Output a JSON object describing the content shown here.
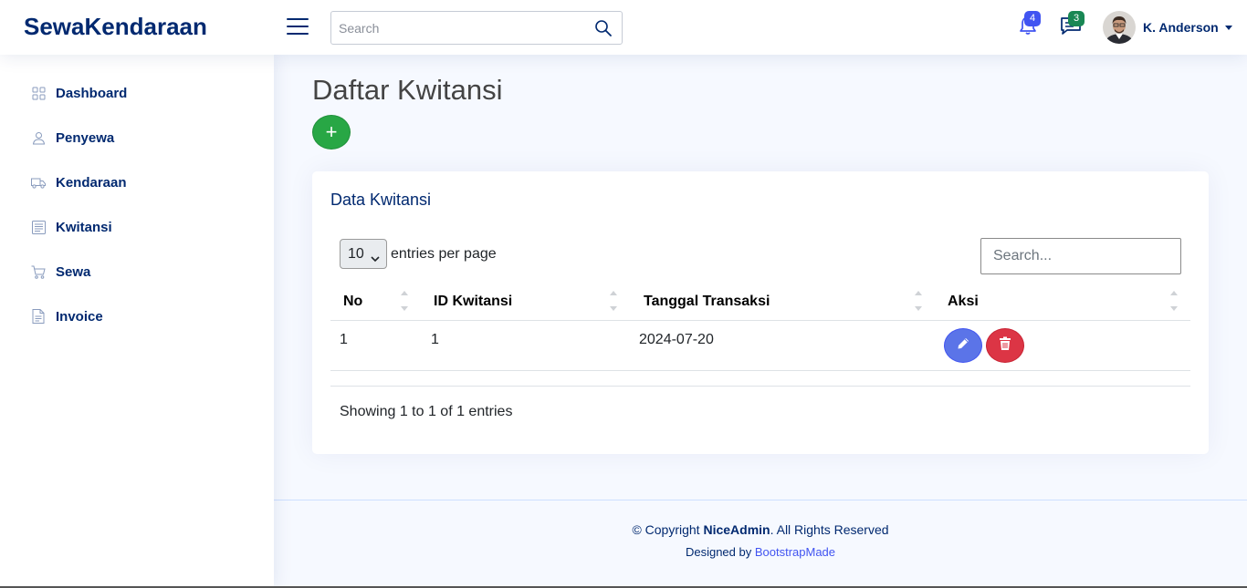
{
  "header": {
    "logo": "SewaKendaraan",
    "search_placeholder": "Search",
    "notifications_count": "4",
    "messages_count": "3",
    "profile_name": "K. Anderson"
  },
  "sidebar": {
    "items": [
      {
        "label": "Dashboard",
        "icon": "grid-icon"
      },
      {
        "label": "Penyewa",
        "icon": "person-icon"
      },
      {
        "label": "Kendaraan",
        "icon": "truck-icon"
      },
      {
        "label": "Kwitansi",
        "icon": "receipt-icon"
      },
      {
        "label": "Sewa",
        "icon": "cart-icon"
      },
      {
        "label": "Invoice",
        "icon": "file-text-icon"
      }
    ]
  },
  "main": {
    "page_title": "Daftar Kwitansi",
    "add_label": "+",
    "card_title": "Data Kwitansi",
    "entries_value": "10",
    "entries_label": "entries per page",
    "table_search_placeholder": "Search...",
    "columns": [
      "No",
      "ID Kwitansi",
      "Tanggal Transaksi",
      "Aksi"
    ],
    "rows": [
      {
        "no": "1",
        "id": "1",
        "tanggal": "2024-07-20"
      }
    ],
    "showing_text": "Showing 1 to 1 of 1 entries"
  },
  "footer": {
    "copyright_prefix": "© Copyright ",
    "brand": "NiceAdmin",
    "copyright_suffix": ". All Rights Reserved",
    "designed_by": "Designed by ",
    "designer": "BootstrapMade"
  },
  "colors": {
    "primary": "#012970",
    "accent": "#4154f1",
    "success": "#28a745",
    "danger": "#dc3545"
  }
}
